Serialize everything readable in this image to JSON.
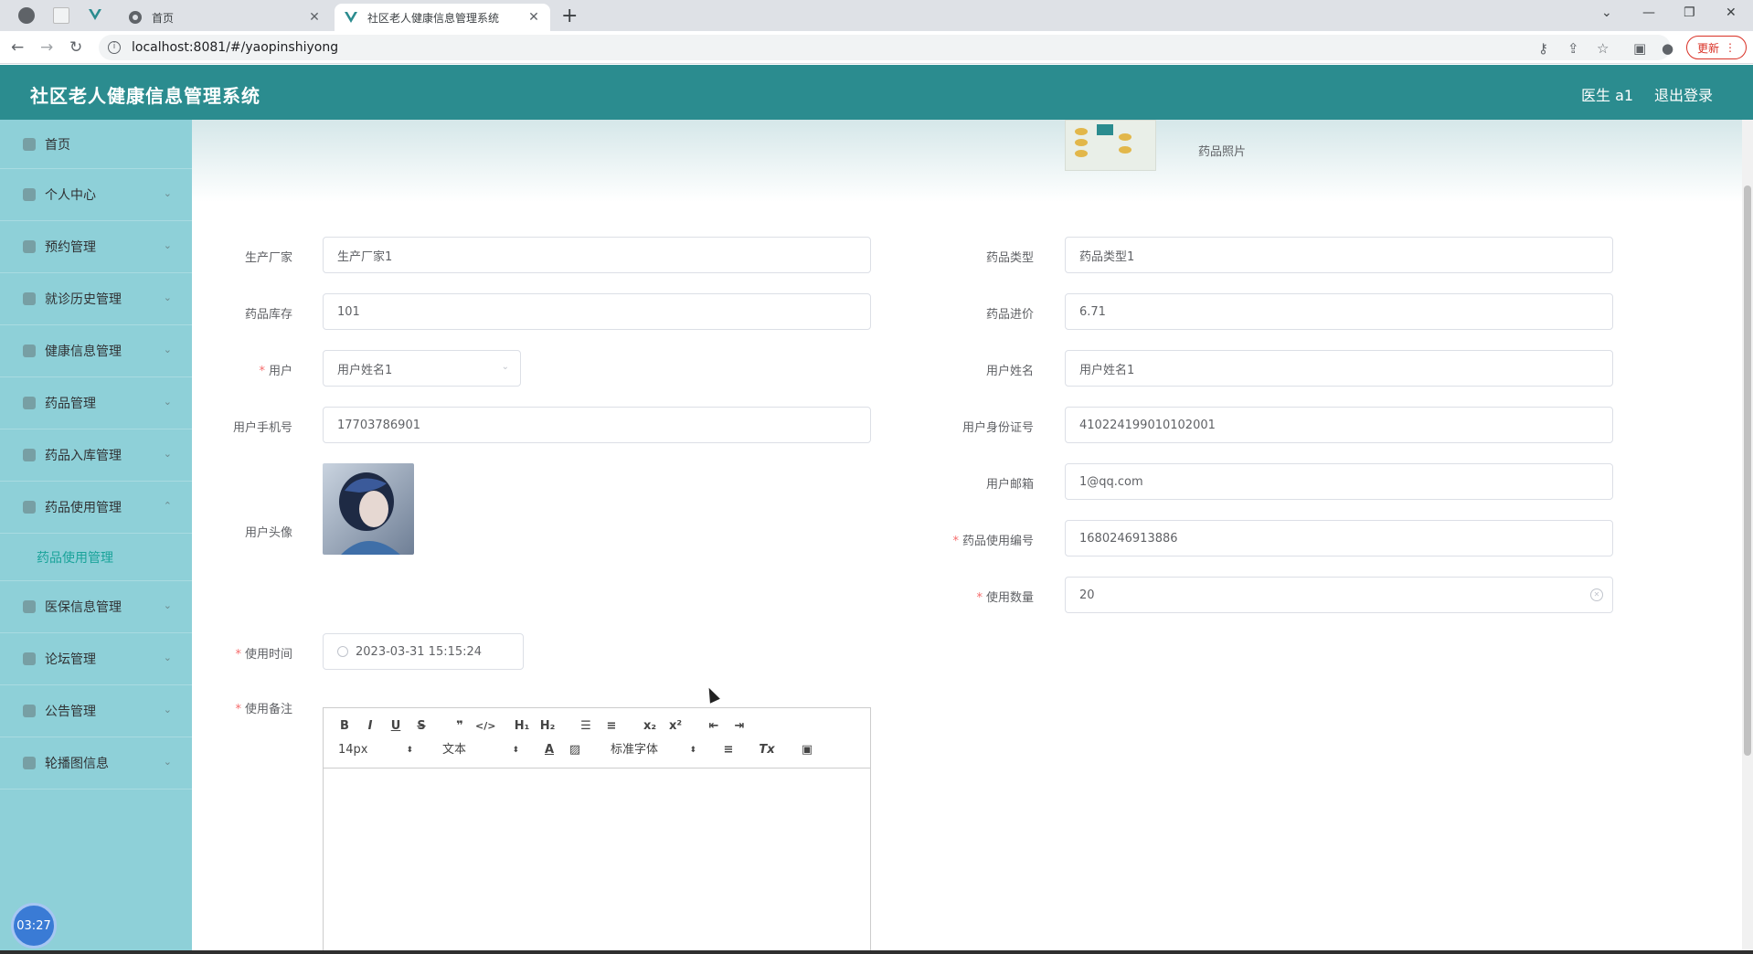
{
  "browser": {
    "tabs": [
      {
        "title": "首页",
        "active": false
      },
      {
        "title": "社区老人健康信息管理系统",
        "active": true
      }
    ],
    "url": "localhost:8081/#/yaopinshiyong",
    "update_label": "更新"
  },
  "header": {
    "title": "社区老人健康信息管理系统",
    "user": "医生 a1",
    "logout": "退出登录"
  },
  "sidebar": {
    "items": [
      {
        "label": "首页",
        "icon": "home-icon"
      },
      {
        "label": "个人中心",
        "icon": "user-icon"
      },
      {
        "label": "预约管理",
        "icon": "menu-icon"
      },
      {
        "label": "就诊历史管理",
        "icon": "history-icon"
      },
      {
        "label": "健康信息管理",
        "icon": "health-icon"
      },
      {
        "label": "药品管理",
        "icon": "drug-icon"
      },
      {
        "label": "药品入库管理",
        "icon": "stock-icon"
      },
      {
        "label": "药品使用管理",
        "icon": "usage-icon"
      },
      {
        "label": "医保信息管理",
        "icon": "insurance-icon"
      },
      {
        "label": "论坛管理",
        "icon": "forum-icon"
      },
      {
        "label": "公告管理",
        "icon": "notice-icon"
      },
      {
        "label": "轮播图信息",
        "icon": "carousel-icon"
      }
    ],
    "submenu_active": "药品使用管理",
    "clock": "03:27"
  },
  "form": {
    "drug_photo_label": "药品照片",
    "manufacturer": {
      "label": "生产厂家",
      "value": "生产厂家1"
    },
    "drug_type": {
      "label": "药品类型",
      "value": "药品类型1"
    },
    "stock": {
      "label": "药品库存",
      "value": "101"
    },
    "purchase_price": {
      "label": "药品进价",
      "value": "6.71"
    },
    "user": {
      "label": "用户",
      "value": "用户姓名1"
    },
    "user_name": {
      "label": "用户姓名",
      "value": "用户姓名1"
    },
    "user_phone": {
      "label": "用户手机号",
      "value": "17703786901"
    },
    "user_id_card": {
      "label": "用户身份证号",
      "value": "410224199010102001"
    },
    "user_avatar_label": "用户头像",
    "user_email": {
      "label": "用户邮箱",
      "value": "1@qq.com"
    },
    "usage_no": {
      "label": "药品使用编号",
      "value": "1680246913886"
    },
    "usage_qty": {
      "label": "使用数量",
      "value": "20"
    },
    "usage_time": {
      "label": "使用时间",
      "value": "2023-03-31 15:15:24"
    },
    "usage_note_label": "使用备注"
  },
  "editor": {
    "font_size": "14px",
    "header_type": "文本",
    "font_family": "标准字体",
    "buttons": [
      "bold",
      "italic",
      "underline",
      "strike",
      "blockquote",
      "code-block",
      "h1",
      "h2",
      "ordered-list",
      "bullet-list",
      "subscript",
      "superscript",
      "indent-decrease",
      "indent-increase",
      "font-color",
      "background-color",
      "align",
      "clean",
      "image"
    ]
  },
  "colors": {
    "header": "#2b8c8f",
    "sidebar": "#8ed0d8",
    "accent": "#1aa39a",
    "required": "#f56c6c"
  }
}
